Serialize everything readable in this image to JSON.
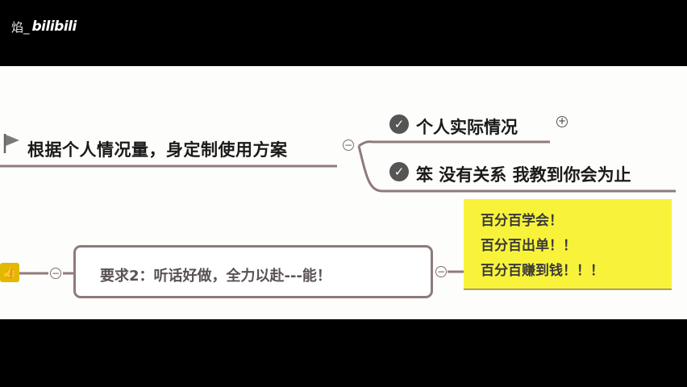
{
  "watermark": {
    "user": "焰_",
    "logo": "bilibili"
  },
  "mindmap": {
    "root": {
      "label": "根据个人情况量，身定制使用方案",
      "icon": "flag-icon"
    },
    "children": [
      {
        "label": "个人实际情况",
        "icon": "check-circle-icon"
      },
      {
        "label": "笨 没有关系  我教到你会为止",
        "icon": "check-circle-icon"
      }
    ],
    "collapse_glyph": "−",
    "expand_glyph": "+",
    "requirement": {
      "label": "要求2：听话好做，全力以赴---能！",
      "icon": "thumbs-up-icon",
      "icon_glyph": "👍"
    },
    "callout": {
      "lines": [
        "百分百学会！",
        "百分百出单！！",
        "百分百赚到钱！！！"
      ],
      "background": "#f8f33a"
    }
  }
}
